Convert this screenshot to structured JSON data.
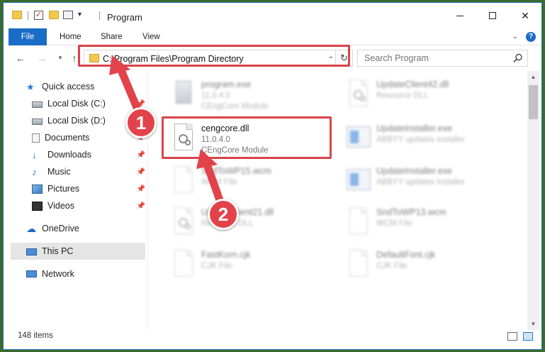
{
  "window": {
    "title": "Program",
    "minimize": "—",
    "maximize": "☐",
    "close": "✕"
  },
  "ribbon": {
    "tabs": [
      "File",
      "Home",
      "Share",
      "View"
    ]
  },
  "address": {
    "path": "C:\\Program Files\\Program Directory",
    "refresh": "↻"
  },
  "search": {
    "placeholder": "Search Program"
  },
  "sidebar": {
    "items": [
      {
        "label": "Quick access",
        "pinned": false
      },
      {
        "label": "Local Disk (C:)",
        "pinned": true
      },
      {
        "label": "Local Disk (D:)",
        "pinned": true
      },
      {
        "label": "Documents",
        "pinned": true
      },
      {
        "label": "Downloads",
        "pinned": true
      },
      {
        "label": "Music",
        "pinned": true
      },
      {
        "label": "Pictures",
        "pinned": true
      },
      {
        "label": "Videos",
        "pinned": true
      },
      {
        "label": "OneDrive",
        "pinned": false
      },
      {
        "label": "This PC",
        "pinned": false,
        "selected": true
      },
      {
        "label": "Network",
        "pinned": false
      }
    ]
  },
  "files": [
    {
      "name": "program.exe",
      "line2": "11.0.4.0",
      "line3": "CEngCore Module",
      "icon": "exe-icon",
      "blurred": true
    },
    {
      "name": "UpdateClient42.dll",
      "line2": "Resource DLL",
      "line3": "",
      "icon": "dll-icon",
      "blurred": true
    },
    {
      "name": "cengcore.dll",
      "line2": "11.0.4.0",
      "line3": "CEngCore Module",
      "icon": "dll-icon",
      "blurred": false
    },
    {
      "name": "UpdateInstaller.exe",
      "line2": "ABBYY updates installer",
      "line3": "",
      "icon": "app-icon",
      "blurred": true
    },
    {
      "name": "SndToWP15.wcm",
      "line2": "WCM File",
      "line3": "",
      "icon": "doc-icon",
      "blurred": true
    },
    {
      "name": "UpdateInstaller.exe",
      "line2": "ABBYY updates installer",
      "line3": "",
      "icon": "app-icon",
      "blurred": true
    },
    {
      "name": "UpdateClient21.dll",
      "line2": "Resource DLL",
      "line3": "",
      "icon": "dll-icon",
      "blurred": true
    },
    {
      "name": "SndToWP13.wcm",
      "line2": "WCM File",
      "line3": "",
      "icon": "doc-icon",
      "blurred": true
    },
    {
      "name": "FastKorn.cjk",
      "line2": "CJK File",
      "line3": "",
      "icon": "doc-icon",
      "blurred": true
    },
    {
      "name": "DefaultFont.cjk",
      "line2": "CJK File",
      "line3": "",
      "icon": "doc-icon",
      "blurred": true
    }
  ],
  "status": {
    "item_count": "148 items"
  },
  "annotations": {
    "step1": "1",
    "step2": "2",
    "highlight_color": "#d9434a"
  },
  "colors": {
    "accent": "#1a6dc6",
    "window_border": "#2b6fc0"
  }
}
